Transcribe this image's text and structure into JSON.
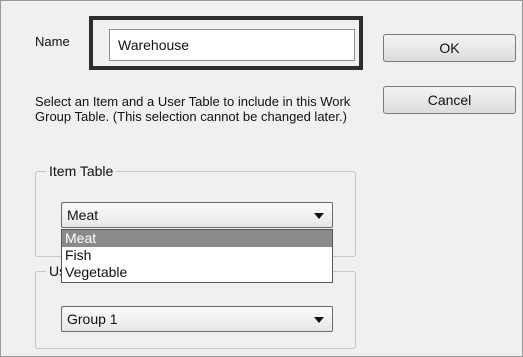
{
  "dialog": {
    "name_label": "Name",
    "name_value": "Warehouse",
    "ok_label": "OK",
    "cancel_label": "Cancel",
    "instructions": "Select an Item and a User Table to include in this Work Group Table. (This selection cannot be changed later.)"
  },
  "item_table": {
    "title": "Item Table",
    "selected": "Meat",
    "options": [
      "Meat",
      "Fish",
      "Vegetable"
    ],
    "highlighted_index": 0
  },
  "user_table": {
    "title_partial": "Us",
    "selected": "Group 1"
  }
}
